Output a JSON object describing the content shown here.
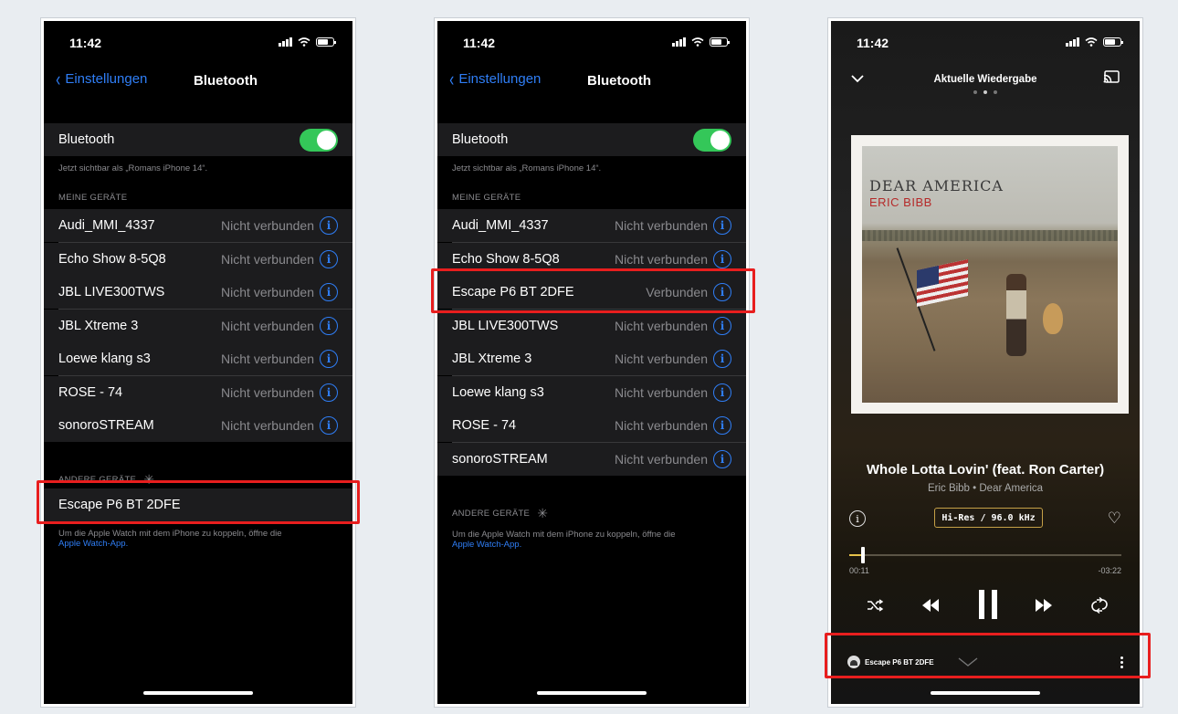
{
  "status": {
    "time": "11:42"
  },
  "settings": {
    "back_label": "Einstellungen",
    "title": "Bluetooth",
    "bluetooth_label": "Bluetooth",
    "bluetooth_on": true,
    "visible_note": "Jetzt sichtbar als „Romans iPhone 14“.",
    "my_devices_header": "MEINE GERÄTE",
    "other_devices_header": "ANDERE GERÄTE",
    "watch_note": "Um die Apple Watch mit dem iPhone zu koppeln, öffne die",
    "watch_link": "Apple Watch-App."
  },
  "screen1": {
    "devices": [
      {
        "name": "Audi_MMI_4337",
        "status": "Nicht verbunden"
      },
      {
        "name": "Echo Show 8-5Q8",
        "status": "Nicht verbunden"
      },
      {
        "name": "JBL LIVE300TWS",
        "status": "Nicht verbunden"
      },
      {
        "name": "JBL Xtreme 3",
        "status": "Nicht verbunden"
      },
      {
        "name": "Loewe klang s3",
        "status": "Nicht verbunden"
      },
      {
        "name": "ROSE - 74",
        "status": "Nicht verbunden"
      },
      {
        "name": "sonoroSTREAM",
        "status": "Nicht verbunden"
      }
    ],
    "other_device": "Escape P6 BT 2DFE"
  },
  "screen2": {
    "devices": [
      {
        "name": "Audi_MMI_4337",
        "status": "Nicht verbunden"
      },
      {
        "name": "Echo Show 8-5Q8",
        "status": "Nicht verbunden"
      },
      {
        "name": "Escape P6 BT 2DFE",
        "status": "Verbunden"
      },
      {
        "name": "JBL LIVE300TWS",
        "status": "Nicht verbunden"
      },
      {
        "name": "JBL Xtreme 3",
        "status": "Nicht verbunden"
      },
      {
        "name": "Loewe klang s3",
        "status": "Nicht verbunden"
      },
      {
        "name": "ROSE - 74",
        "status": "Nicht verbunden"
      },
      {
        "name": "sonoroSTREAM",
        "status": "Nicht verbunden"
      }
    ]
  },
  "player": {
    "title": "Aktuelle Wiedergabe",
    "page_dots": 3,
    "active_dot": 1,
    "cover_title": "DEAR AMERICA",
    "cover_artist": "ERIC BIBB",
    "song": "Whole Lotta Lovin' (feat. Ron Carter)",
    "artist_album": "Eric Bibb • Dear America",
    "quality": "Hi-Res / 96.0 kHz",
    "elapsed": "00:11",
    "remaining": "-03:22",
    "progress_fraction": 0.05,
    "device": "Escape P6 BT 2DFE"
  },
  "colors": {
    "accent_blue": "#2f7ef6",
    "toggle_green": "#34c759",
    "highlight_red": "#e81e1e",
    "gold": "#c5a047"
  },
  "icons": {
    "back": "chevron-left-icon",
    "info": "info-icon",
    "down": "chevron-down-icon",
    "cast": "cast-icon",
    "heart": "heart-icon",
    "shuffle": "shuffle-icon",
    "previous": "previous-icon",
    "pause": "pause-icon",
    "next": "next-icon",
    "repeat": "repeat-icon",
    "more": "more-icon"
  }
}
